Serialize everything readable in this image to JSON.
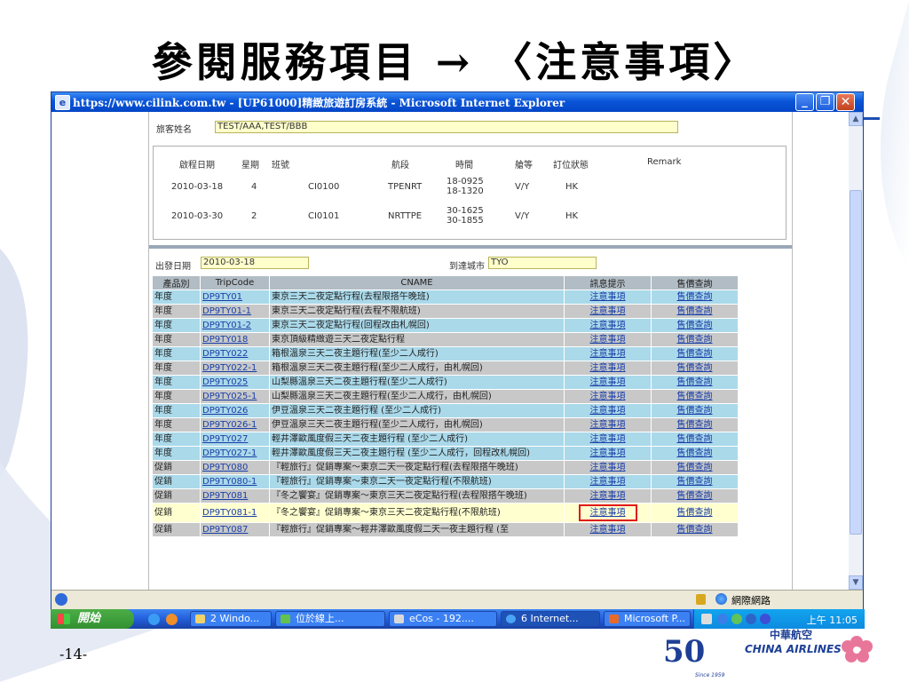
{
  "slide": {
    "title": "參閱服務項目 → 〈注意事項〉",
    "page_number": "-14-"
  },
  "window": {
    "title": "https://www.cilink.com.tw - [UP61000]精緻旅遊訂房系統 - Microsoft Internet Explorer",
    "min_icon": "minimize-icon",
    "max_icon": "maximize-icon",
    "close_icon": "close-icon"
  },
  "passenger": {
    "label": "旅客姓名",
    "value": "TEST/AAA,TEST/BBB"
  },
  "flights": {
    "headers": [
      "啟程日期",
      "星期",
      "班號",
      "航段",
      "時間",
      "艙等",
      "訂位狀態",
      "Remark"
    ],
    "rows": [
      {
        "date": "2010-03-18",
        "weekday": "4",
        "flight": "CI0100",
        "route": "TPENRT",
        "time1": "18-0925",
        "time2": "18-1320",
        "cls": "V/Y",
        "status": "HK"
      },
      {
        "date": "2010-03-30",
        "weekday": "2",
        "flight": "CI0101",
        "route": "NRTTPE",
        "time1": "30-1625",
        "time2": "30-1855",
        "cls": "V/Y",
        "status": "HK"
      }
    ]
  },
  "search": {
    "depart_label": "出發日期",
    "depart_value": "2010-03-18",
    "city_label": "到達城市",
    "city_value": "TYO"
  },
  "table": {
    "headers": [
      "產品別",
      "TripCode",
      "CNAME",
      "訊息提示",
      "售價查詢"
    ],
    "notice_text": "注意事項",
    "price_text": "售價查詢",
    "rows": [
      {
        "type": "年度",
        "code": "DP9TY01",
        "name": "東京三天二夜定點行程(去程限搭午晚班)",
        "color": "blue"
      },
      {
        "type": "年度",
        "code": "DP9TY01-1",
        "name": "東京三天二夜定點行程(去程不限航班)",
        "color": "gray"
      },
      {
        "type": "年度",
        "code": "DP9TY01-2",
        "name": "東京三天二夜定點行程(回程改由札幌回)",
        "color": "blue"
      },
      {
        "type": "年度",
        "code": "DP9TY018",
        "name": "東京頂級精緻遊三天二夜定點行程",
        "color": "gray"
      },
      {
        "type": "年度",
        "code": "DP9TY022",
        "name": "箱根溫泉三天二夜主題行程(至少二人成行)",
        "color": "blue"
      },
      {
        "type": "年度",
        "code": "DP9TY022-1",
        "name": "箱根溫泉三天二夜主題行程(至少二人成行，由札幌回)",
        "color": "gray"
      },
      {
        "type": "年度",
        "code": "DP9TY025",
        "name": "山梨縣溫泉三天二夜主題行程(至少二人成行)",
        "color": "blue"
      },
      {
        "type": "年度",
        "code": "DP9TY025-1",
        "name": "山梨縣溫泉三天二夜主題行程(至少二人成行，由札幌回)",
        "color": "gray"
      },
      {
        "type": "年度",
        "code": "DP9TY026",
        "name": "伊豆溫泉三天二夜主題行程 (至少二人成行)",
        "color": "blue"
      },
      {
        "type": "年度",
        "code": "DP9TY026-1",
        "name": "伊豆溫泉三天二夜主題行程(至少二人成行，由札幌回)",
        "color": "gray"
      },
      {
        "type": "年度",
        "code": "DP9TY027",
        "name": "輕井澤歐風度假三天二夜主題行程 (至少二人成行)",
        "color": "blue"
      },
      {
        "type": "年度",
        "code": "DP9TY027-1",
        "name": "輕井澤歐風度假三天二夜主題行程 (至少二人成行，回程改札幌回)",
        "color": "blue"
      },
      {
        "type": "促銷",
        "code": "DP9TY080",
        "name": "『輕旅行』促銷專案～東京二天一夜定點行程(去程限搭午晚班)",
        "color": "gray"
      },
      {
        "type": "促銷",
        "code": "DP9TY080-1",
        "name": "『輕旅行』促銷專案～東京二天一夜定點行程(不限航班)",
        "color": "blue"
      },
      {
        "type": "促銷",
        "code": "DP9TY081",
        "name": "『冬之饗宴』促銷專案～東京三天二夜定點行程(去程限搭午晚班)",
        "color": "gray"
      },
      {
        "type": "促銷",
        "code": "DP9TY081-1",
        "name": "『冬之饗宴』促銷專案～東京三天二夜定點行程(不限航班)",
        "color": "yellow",
        "highlight": true
      },
      {
        "type": "促銷",
        "code": "DP9TY087",
        "name": "『輕旅行』促銷專案～輕井澤歐風度假二天一夜主題行程 (至",
        "color": "gray"
      }
    ]
  },
  "statusbar": {
    "zone": "網際網路",
    "lock_icon": "lock-icon",
    "globe_icon": "globe-icon"
  },
  "taskbar": {
    "start": "開始",
    "items": [
      {
        "label": "2 Windo...",
        "icon": "windows-explorer-icon"
      },
      {
        "label": "位於線上...",
        "icon": "messenger-icon"
      },
      {
        "label": "eCos - 192....",
        "icon": "ecos-icon"
      },
      {
        "label": "6 Internet...",
        "icon": "internet-explorer-icon"
      },
      {
        "label": "Microsoft P...",
        "icon": "powerpoint-icon"
      }
    ],
    "clock": "上午 11:05"
  },
  "brand": {
    "name_cn": "中華航空",
    "name_en": "CHINA AIRLINES",
    "anniversary": "50",
    "since": "Since 1959"
  },
  "colors": {
    "title_bar": "#0a55d9",
    "row_blue": "#aad9ea",
    "row_gray": "#c7c8c7",
    "row_highlight": "#ffffd0",
    "highlight_border": "#e0191c",
    "link": "#1a3ea8"
  }
}
